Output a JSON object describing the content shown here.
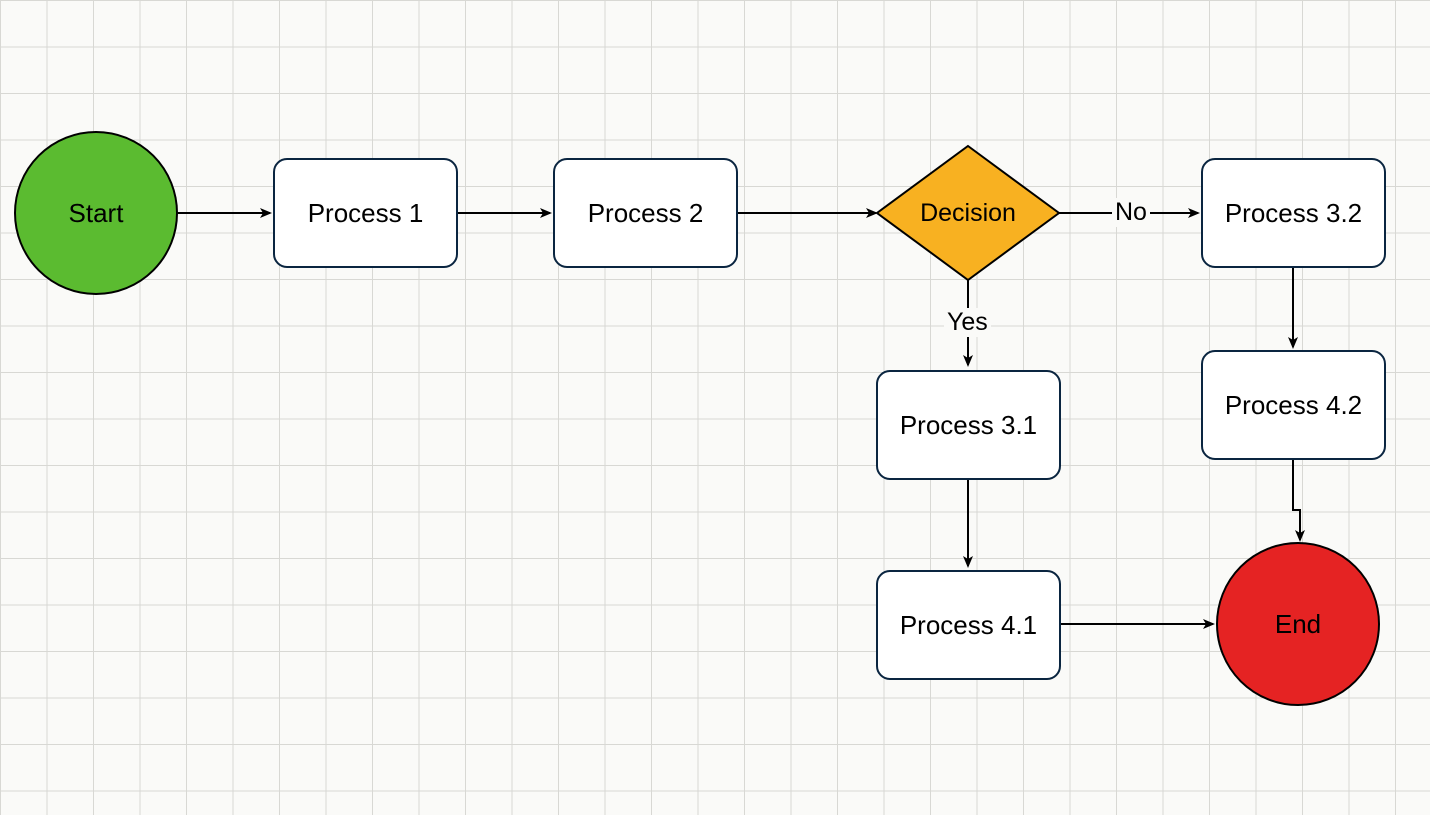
{
  "nodes": {
    "start": {
      "label": "Start"
    },
    "p1": {
      "label": "Process 1"
    },
    "p2": {
      "label": "Process 2"
    },
    "decision": {
      "label": "Decision"
    },
    "p31": {
      "label": "Process 3.1"
    },
    "p32": {
      "label": "Process 3.2"
    },
    "p41": {
      "label": "Process 4.1"
    },
    "p42": {
      "label": "Process 4.2"
    },
    "end": {
      "label": "End"
    }
  },
  "edges": {
    "yes": {
      "label": "Yes"
    },
    "no": {
      "label": "No"
    }
  },
  "colors": {
    "start": "#5bbb30",
    "end": "#e52323",
    "decision": "#f8b121"
  }
}
